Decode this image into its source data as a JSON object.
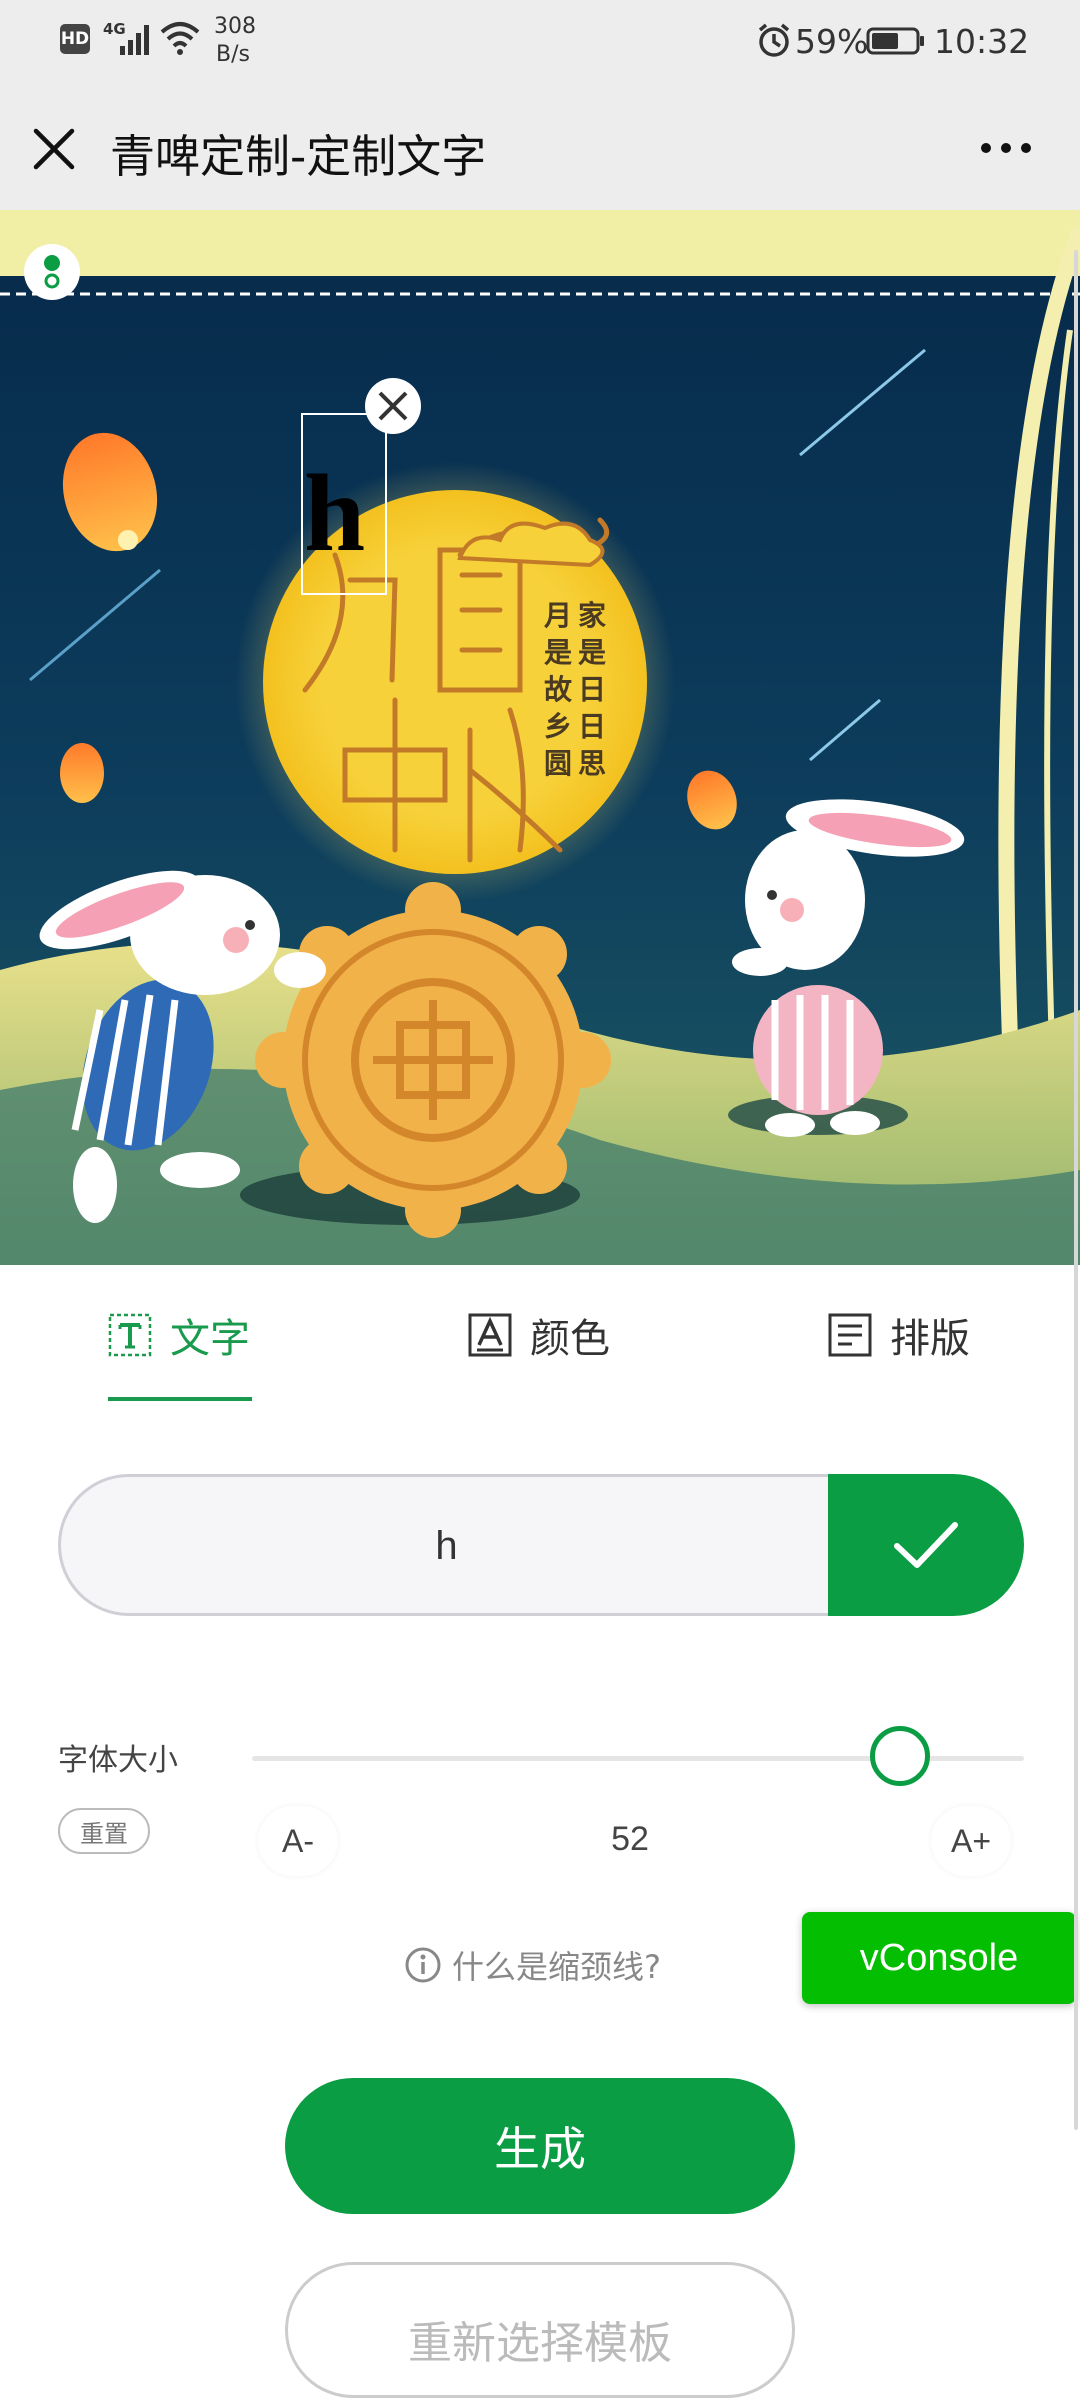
{
  "status_bar": {
    "hd": "HD",
    "net": "4G",
    "speed": "308",
    "speed_unit": "B/s",
    "battery": "59%",
    "time": "10:32"
  },
  "title_bar": {
    "title": "青啤定制-定制文字"
  },
  "canvas": {
    "overlay_text": "h",
    "poem": [
      "月",
      "是",
      "故",
      "乡",
      "圆",
      "家",
      "是",
      "日",
      "日",
      "思"
    ],
    "title_chars": [
      "月",
      "圆",
      "中",
      "秋"
    ]
  },
  "tabs": [
    {
      "label": "文字",
      "active": true
    },
    {
      "label": "颜色",
      "active": false
    },
    {
      "label": "排版",
      "active": false
    }
  ],
  "text_input": {
    "value": "h"
  },
  "font_size": {
    "label": "字体大小",
    "reset": "重置",
    "decrease": "A-",
    "increase": "A+",
    "value": "52",
    "slider_fraction": 0.84
  },
  "help_link": "什么是缩颈线?",
  "vconsole": "vConsole",
  "generate": "生成",
  "reselect": "重新选择模板",
  "colors": {
    "accent": "#0a9d44",
    "vconsole": "#04be02"
  }
}
